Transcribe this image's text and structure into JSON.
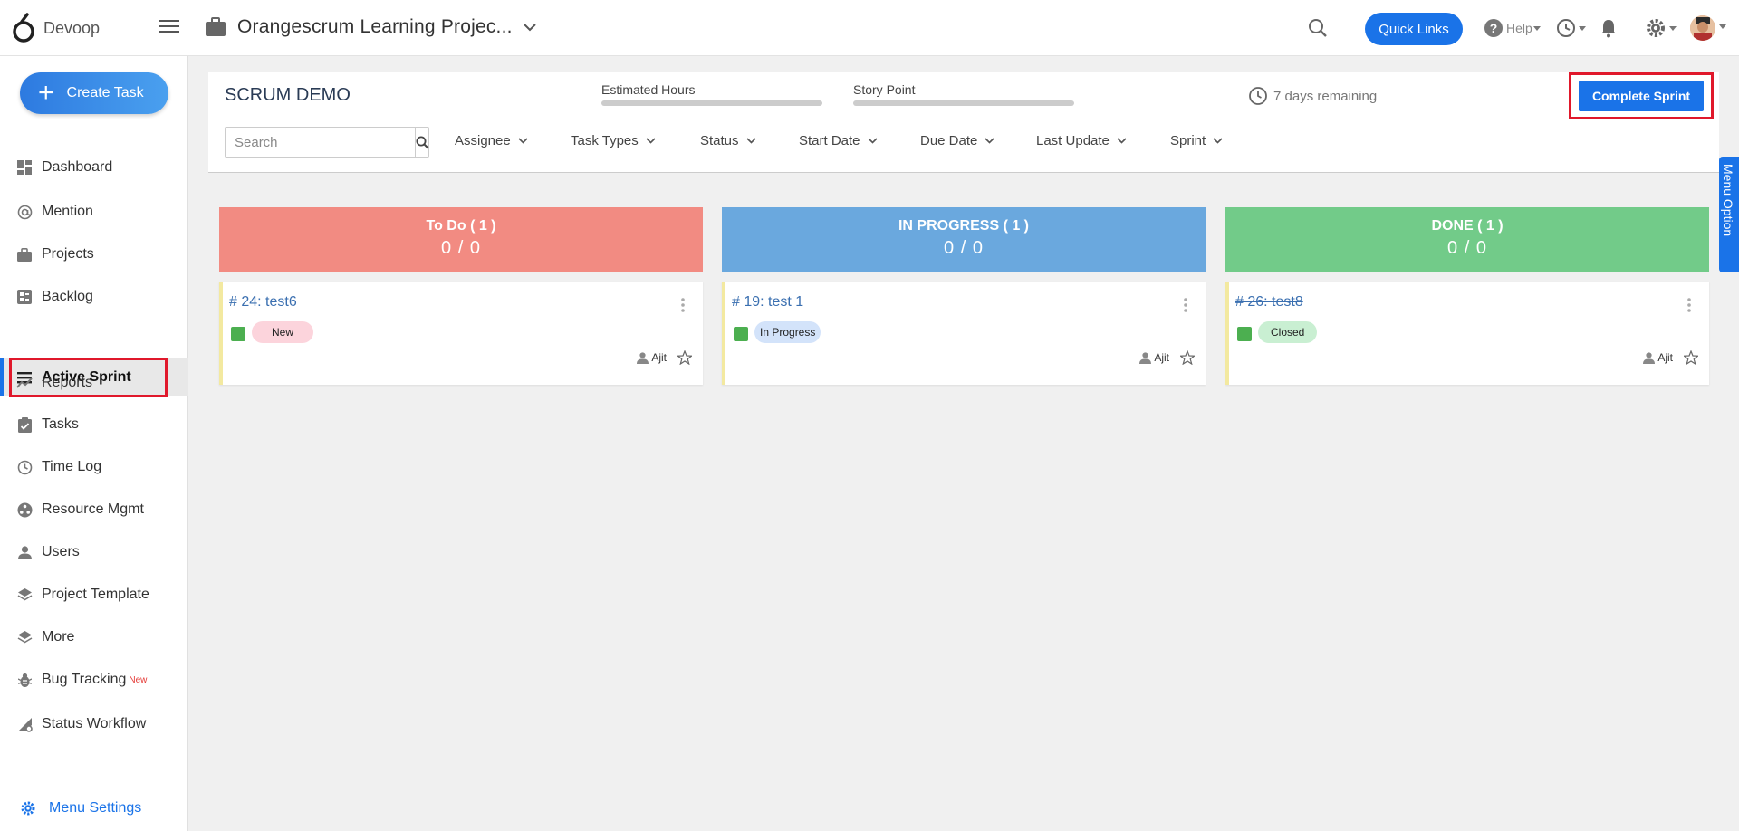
{
  "brand": {
    "name": "Devoop"
  },
  "header": {
    "project_title": "Orangescrum Learning Projec...",
    "quick_links": "Quick Links",
    "help": "Help"
  },
  "sidebar": {
    "create_task": "Create Task",
    "items": [
      {
        "label": "Dashboard",
        "icon": "dashboard-icon"
      },
      {
        "label": "Mention",
        "icon": "at-icon"
      },
      {
        "label": "Projects",
        "icon": "briefcase-icon"
      },
      {
        "label": "Backlog",
        "icon": "backlog-icon"
      },
      {
        "label": "Active Sprint",
        "icon": "sprint-icon",
        "active": true
      },
      {
        "label": "Reports",
        "icon": "trend-icon"
      },
      {
        "label": "Tasks",
        "icon": "clipboard-icon"
      },
      {
        "label": "Time Log",
        "icon": "clock-icon"
      },
      {
        "label": "Resource Mgmt",
        "icon": "resource-icon"
      },
      {
        "label": "Users",
        "icon": "user-icon"
      },
      {
        "label": "Project Template",
        "icon": "layers-icon"
      },
      {
        "label": "More",
        "icon": "layers-icon"
      },
      {
        "label": "Bug Tracking",
        "icon": "bug-icon",
        "badge": "New"
      },
      {
        "label": "Status Workflow",
        "icon": "workflow-icon"
      }
    ],
    "menu_settings": "Menu Settings"
  },
  "sprint": {
    "name": "SCRUM DEMO",
    "estimated_hours_label": "Estimated Hours",
    "estimated_hours_progress": 0,
    "story_point_label": "Story Point",
    "story_point_progress": 0,
    "remaining": "7 days remaining",
    "complete_button": "Complete Sprint"
  },
  "filters": {
    "search_placeholder": "Search",
    "items": [
      "Assignee",
      "Task Types",
      "Status",
      "Start Date",
      "Due Date",
      "Last Update",
      "Sprint"
    ]
  },
  "menu_option": "Menu Option",
  "columns": [
    {
      "title": "To Do ( 1 )",
      "count": "0 / 0",
      "color": "#f28b82",
      "card": {
        "title": "# 24: test6",
        "status": "New",
        "status_bg": "#fcd4dc",
        "user": "Ajit",
        "closed": false
      }
    },
    {
      "title": "IN PROGRESS ( 1 )",
      "count": "0 / 0",
      "color": "#6aa8de",
      "card": {
        "title": "# 19: test 1",
        "status": "In Progress",
        "status_bg": "#d3e3fa",
        "user": "Ajit",
        "closed": false
      }
    },
    {
      "title": "DONE ( 1 )",
      "count": "0 / 0",
      "color": "#72cb89",
      "card": {
        "title": "# 26: test8",
        "status": "Closed",
        "status_bg": "#c9efd2",
        "user": "Ajit",
        "closed": true
      }
    }
  ],
  "colors": {
    "accent": "#1a73e8",
    "highlight": "#e0182b"
  }
}
